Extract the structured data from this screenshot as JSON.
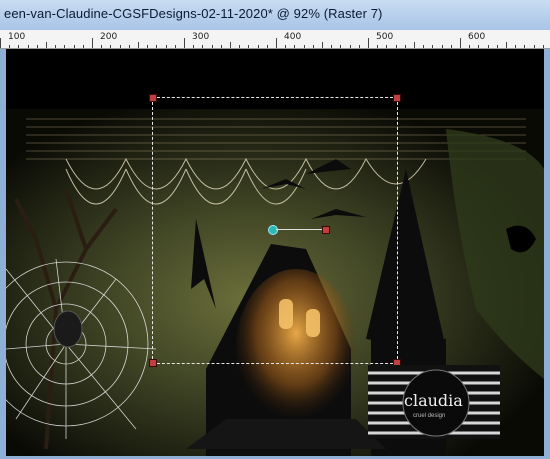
{
  "window": {
    "title": "een-van-Claudine-CGSFDesigns-02-11-2020* @  92% (Raster 7)"
  },
  "ruler": {
    "labels": [
      "100",
      "200",
      "300",
      "400",
      "500",
      "600"
    ]
  },
  "canvas": {
    "layer": "Raster 7",
    "zoom": "92%"
  },
  "watermark": {
    "brand": "claudia",
    "tagline": "cruel design"
  },
  "colors": {
    "titlebar": "#b8d0ee",
    "selection_handle": "#c04040",
    "ruler_bg": "#f4f4f4"
  }
}
